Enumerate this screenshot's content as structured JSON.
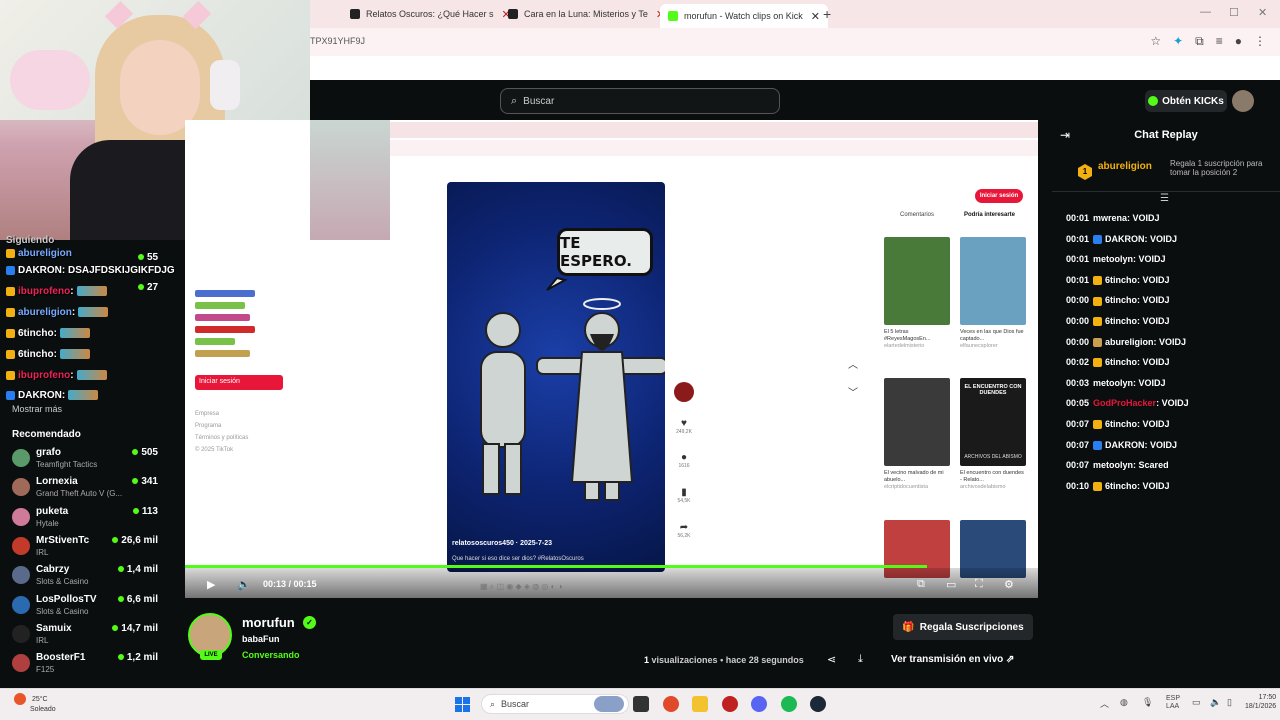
{
  "browser": {
    "tabs": [
      {
        "label": "Relatos Oscuros: ¿Qué Hacer s"
      },
      {
        "label": "Cara en la Luna: Misterios y Te"
      },
      {
        "label": "morufun - Watch clips on Kick"
      }
    ],
    "url_fragment": "TPX91YHF9J",
    "new_tab_label": "+"
  },
  "kick": {
    "search_placeholder": "Buscar",
    "get_kicks": "Obtén KICKs"
  },
  "left": {
    "overlay_lines": [
      {
        "user": "Siguiendo",
        "text": ""
      },
      {
        "user": "abureligion",
        "text": ""
      },
      {
        "user": "DAKRON",
        "text": ": DSAJFDSKIJGIKFDJG"
      },
      {
        "user": "ibuprofeno",
        "text": ":"
      },
      {
        "user": "abureligion",
        "text": ":"
      },
      {
        "user": "6tincho",
        "text": ":"
      },
      {
        "user": "6tincho",
        "text": ":"
      },
      {
        "user": "ibuprofeno",
        "text": ":"
      },
      {
        "user": "DAKRON",
        "text": ":"
      }
    ],
    "follow_counts": [
      "55",
      "27"
    ],
    "show_more": "Mostrar más",
    "recommended_heading": "Recomendado",
    "recommended": [
      {
        "name": "grafo",
        "category": "Teamfight Tactics",
        "viewers": "505",
        "color": "#5a9a6a"
      },
      {
        "name": "Lornexia",
        "category": "Grand Theft Auto V (G...",
        "viewers": "341",
        "color": "#a06a5a"
      },
      {
        "name": "puketa",
        "category": "Hytale",
        "viewers": "113",
        "color": "#d07a9a"
      },
      {
        "name": "MrStivenTc",
        "category": "IRL",
        "viewers": "26,6 mil",
        "color": "#c23a2a"
      },
      {
        "name": "Cabrzy",
        "category": "Slots & Casino",
        "viewers": "1,4 mil",
        "color": "#5a6a8a"
      },
      {
        "name": "LosPollosTV",
        "category": "Slots & Casino",
        "viewers": "6,6 mil",
        "color": "#2a6ab0"
      },
      {
        "name": "Samuix",
        "category": "IRL",
        "viewers": "14,7 mil",
        "color": "#222"
      },
      {
        "name": "BoosterF1",
        "category": "F125",
        "viewers": "1,2 mil",
        "color": "#b04040"
      }
    ]
  },
  "video": {
    "bubble_text": "TE ESPERO.",
    "tiktok_user": "relatososcuros450 · 2025-7-23",
    "tiktok_desc": "Que hacer si eso dice ser dios? #RelatosOscuros",
    "login_label": "Iniciar sesión",
    "tabs": [
      "Comentarios",
      "Podría interesarte"
    ],
    "side_actions": [
      {
        "icon": "♥",
        "count": "249,2K"
      },
      {
        "icon": "●",
        "count": "1616"
      },
      {
        "icon": "▮",
        "count": "54,5K"
      },
      {
        "icon": "➦",
        "count": "56,2K"
      }
    ],
    "thumbs": [
      {
        "title": "El 5 letras #ReyesMagosEn...",
        "sub": "elartedelmisterio",
        "bg": "#4a7a3a"
      },
      {
        "title": "Veces en las que Dios fue captado...",
        "sub": "elfaunecsplorer",
        "bg": "#6aa0c0"
      },
      {
        "title": "El vecino malvado de mi abuelo...",
        "sub": "elcriptidocuentista",
        "bg": "#3a3a3a"
      },
      {
        "title": "El encuentro con duendes - Relato...",
        "sub": "archivosdelabismo",
        "bg": "#1a1a1a"
      },
      {
        "title": "",
        "sub": "",
        "bg": "#c04040"
      },
      {
        "title": "",
        "sub": "",
        "bg": "#2a4a7a"
      }
    ],
    "thumb4_text": "EL ENCUENTRO CON DUENDES",
    "thumb4_sub": "ARCHIVOS DEL ABISMO",
    "mini_login": "Iniciar sesión",
    "mini_footer": [
      "Empresa",
      "Programa",
      "Términos y políticas",
      "© 2025 TikTok"
    ],
    "time_current": "00:13",
    "time_total": "00:15",
    "progress": 0.87
  },
  "chat": {
    "title": "Chat Replay",
    "pinned_user": "abureligion",
    "pinned_rank": "1",
    "pinned_msg": "Regala 1 suscripción para tomar la posición 2",
    "messages": [
      {
        "ts": "00:01",
        "user": "mwrena",
        "msg": "VOIDJ",
        "badge": "",
        "color": "#ffffff"
      },
      {
        "ts": "00:01",
        "user": "DAKRON",
        "msg": "VOIDJ",
        "badge": "#2a7ff0",
        "color": "#ffffff"
      },
      {
        "ts": "00:01",
        "user": "metoolyn",
        "msg": "VOIDJ",
        "badge": "",
        "color": "#ffffff"
      },
      {
        "ts": "00:01",
        "user": "6tincho",
        "msg": "VOIDJ",
        "badge": "#f2b111",
        "color": "#ffffff"
      },
      {
        "ts": "00:00",
        "user": "6tincho",
        "msg": "VOIDJ",
        "badge": "#f2b111",
        "color": "#ffffff"
      },
      {
        "ts": "00:00",
        "user": "6tincho",
        "msg": "VOIDJ",
        "badge": "#f2b111",
        "color": "#ffffff"
      },
      {
        "ts": "00:00",
        "user": "abureligion",
        "msg": "VOIDJ",
        "badge": "#c9a050",
        "color": "#ffffff"
      },
      {
        "ts": "00:02",
        "user": "6tincho",
        "msg": "VOIDJ",
        "badge": "#f2b111",
        "color": "#ffffff"
      },
      {
        "ts": "00:03",
        "user": "metoolyn",
        "msg": "VOIDJ",
        "badge": "",
        "color": "#ffffff"
      },
      {
        "ts": "00:05",
        "user": "GodProHacker",
        "msg": "VOIDJ",
        "badge": "",
        "color": "#e8173a"
      },
      {
        "ts": "00:07",
        "user": "6tincho",
        "msg": "VOIDJ",
        "badge": "#f2b111",
        "color": "#ffffff"
      },
      {
        "ts": "00:07",
        "user": "DAKRON",
        "msg": "VOIDJ",
        "badge": "#2a7ff0",
        "color": "#ffffff"
      },
      {
        "ts": "00:07",
        "user": "metoolyn",
        "msg": "Scared",
        "badge": "",
        "color": "#ffffff"
      },
      {
        "ts": "00:10",
        "user": "6tincho",
        "msg": "VOIDJ",
        "badge": "#f2b111",
        "color": "#ffffff"
      }
    ]
  },
  "streamer": {
    "name": "morufun",
    "title": "babaFun",
    "category": "Conversando",
    "live": "LIVE",
    "gift_subs": "Regala Suscripciones",
    "views_count": "1",
    "views_text": "visualizaciones • hace 28 segundos",
    "watch_live": "Ver transmisión en vivo"
  },
  "taskbar": {
    "temp": "25°C",
    "weather": "Soleado",
    "search": "Buscar",
    "lang": "ESP",
    "lang2": "LAA",
    "time": "17:50",
    "date": "18/1/2026"
  },
  "colors": {
    "kick_green": "#53fc18",
    "tiktok_red": "#e8173a",
    "gold": "#f2b111"
  }
}
